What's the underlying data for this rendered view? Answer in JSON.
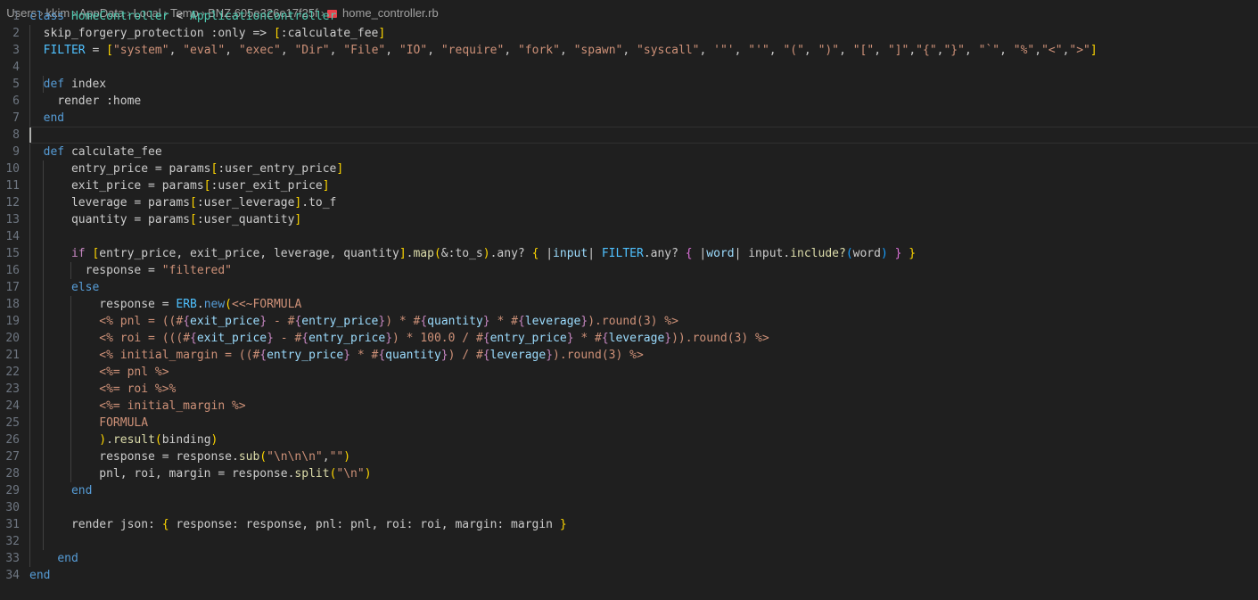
{
  "breadcrumb": {
    "parts": [
      "Users",
      "kkim",
      "AppData",
      "Local",
      "Temp",
      "BNZ.605e326e17f25f"
    ],
    "file": "home_controller.rb"
  },
  "editor": {
    "line_numbers": [
      "1",
      "2",
      "3",
      "4",
      "5",
      "6",
      "7",
      "8",
      "9",
      "10",
      "11",
      "12",
      "13",
      "14",
      "15",
      "16",
      "17",
      "18",
      "19",
      "20",
      "21",
      "22",
      "23",
      "24",
      "25",
      "26",
      "27",
      "28",
      "29",
      "30",
      "31",
      "32",
      "33",
      "34"
    ],
    "current_line": 8,
    "lines": [
      "class HomeController < ApplicationController",
      "  skip_forgery_protection :only => [:calculate_fee]",
      "  FILTER = [\"system\", \"eval\", \"exec\", \"Dir\", \"File\", \"IO\", \"require\", \"fork\", \"spawn\", \"syscall\", '\"', \"'\", \"(\", \")\", \"[\", \"]\",\"{\",\"}\", \"`\", \"%\",\"<\",\">\"]",
      "",
      "  def index",
      "    render :home",
      "  end",
      "",
      "  def calculate_fee",
      "      entry_price = params[:user_entry_price]",
      "      exit_price = params[:user_exit_price]",
      "      leverage = params[:user_leverage].to_f",
      "      quantity = params[:user_quantity]",
      "",
      "      if [entry_price, exit_price, leverage, quantity].map(&:to_s).any? { |input| FILTER.any? { |word| input.include?(word) } }",
      "        response = \"filtered\"",
      "      else",
      "          response = ERB.new(<<~FORMULA",
      "          <% pnl = ((#{exit_price} - #{entry_price}) * #{quantity} * #{leverage}).round(3) %>",
      "          <% roi = (((#{exit_price} - #{entry_price}) * 100.0 / #{entry_price} * #{leverage})).round(3) %>",
      "          <% initial_margin = ((#{entry_price} * #{quantity}) / #{leverage}).round(3) %>",
      "          <%= pnl %>",
      "          <%= roi %>%",
      "          <%= initial_margin %>",
      "          FORMULA",
      "          ).result(binding)",
      "          response = response.sub(\"\\n\\n\\n\",\"\")",
      "          pnl, roi, margin = response.split(\"\\n\")",
      "      end",
      "",
      "      render json: { response: response, pnl: pnl, roi: roi, margin: margin }",
      "",
      "    end",
      "end"
    ]
  },
  "colors": {
    "background": "#1f1f1f",
    "keyword": "#569cd6",
    "control": "#c586c0",
    "class": "#4ec9b0",
    "function": "#dcdcaa",
    "string": "#ce9178",
    "variable": "#9cdcfe",
    "bracket_gold": "#ffd700",
    "bracket_orchid": "#da70d6",
    "bracket_blue": "#179fff"
  }
}
